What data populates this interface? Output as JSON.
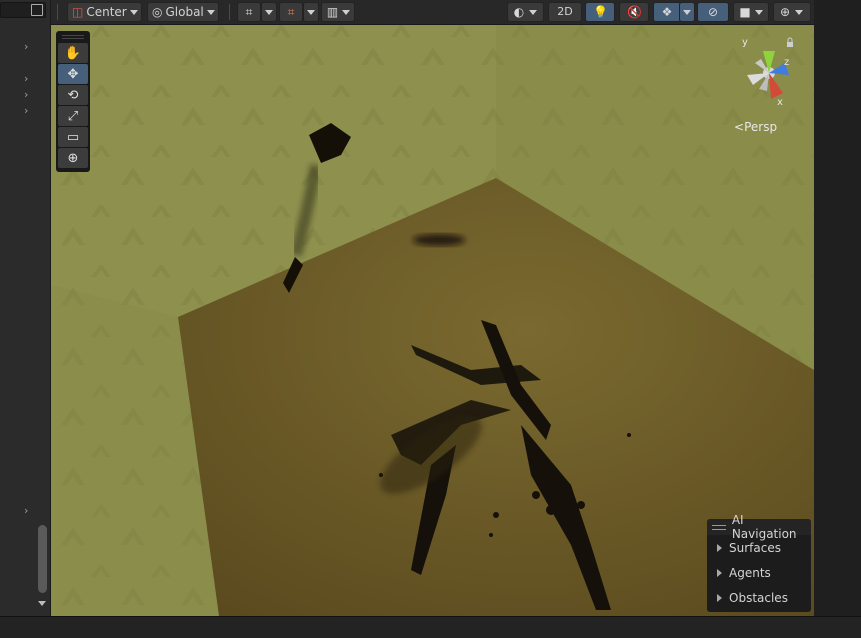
{
  "toolbar": {
    "pivot_mode": "Center",
    "pivot_rotation": "Global",
    "view_2d": "2D",
    "icons": [
      "pivot-icon",
      "globe-icon",
      "grid-snap-icon",
      "increment-snap-icon",
      "ruler-grid-icon",
      "shading-sphere-icon",
      "light-bulb-icon",
      "audio-mute-icon",
      "effects-layers-icon",
      "visibility-icon",
      "camera-icon",
      "gizmos-icon"
    ]
  },
  "tools": [
    {
      "name": "hand-tool",
      "glyph": "✋"
    },
    {
      "name": "move-tool",
      "glyph": "✥",
      "selected": true
    },
    {
      "name": "rotate-tool",
      "glyph": "⟲"
    },
    {
      "name": "scale-tool",
      "glyph": "⤢"
    },
    {
      "name": "rect-tool",
      "glyph": "▭"
    },
    {
      "name": "transform-tool",
      "glyph": "⊕"
    }
  ],
  "gizmo": {
    "axis_y": "y",
    "axis_z": "z",
    "axis_x": "x",
    "projection": "Persp",
    "colors": {
      "y": "#8ed33e",
      "z": "#3f7ce0",
      "x": "#d24a3a"
    }
  },
  "ai_navigation": {
    "title": "AI Navigation",
    "items": [
      "Surfaces",
      "Agents",
      "Obstacles"
    ]
  },
  "colors": {
    "accent_active": "#46607c",
    "wall": "#8d8f4d",
    "floor": "#6d5a26"
  }
}
